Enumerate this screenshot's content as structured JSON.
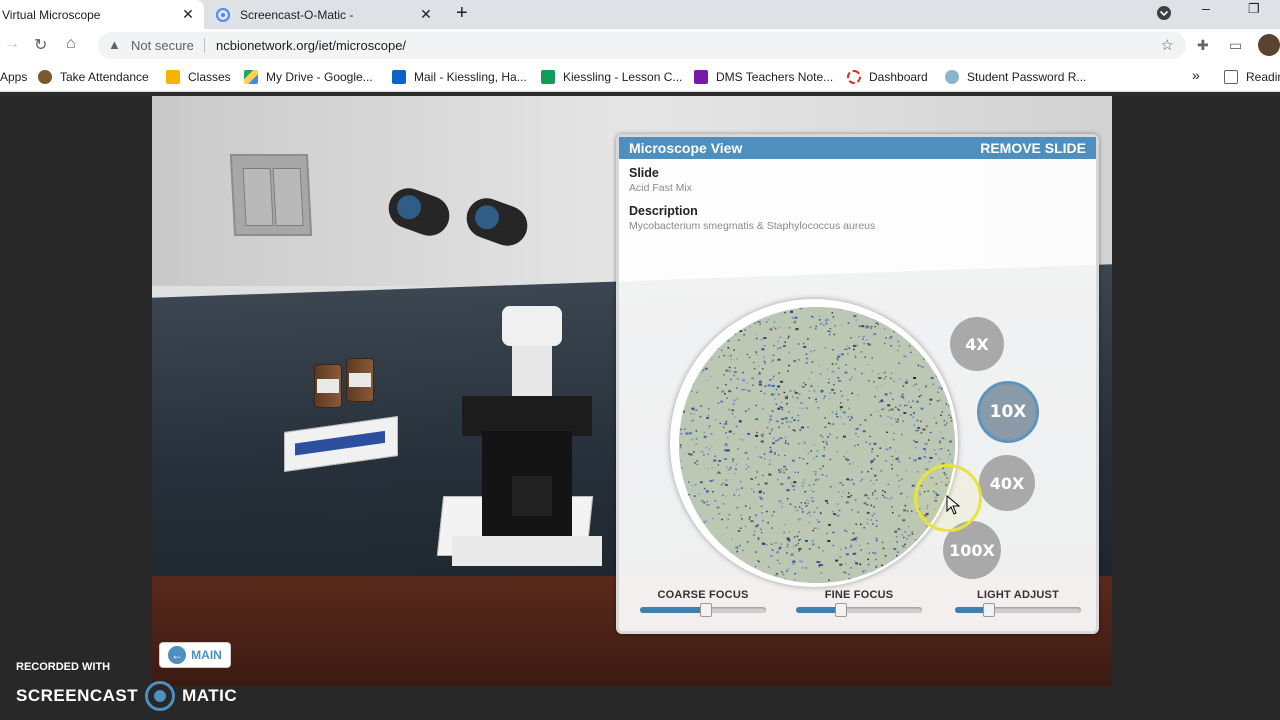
{
  "browser": {
    "tabs": [
      {
        "title": "Virtual Microscope",
        "active": true
      },
      {
        "title": "Screencast-O-Matic -",
        "active": false
      }
    ],
    "address": {
      "security": "Not secure",
      "url": "ncbionetwork.org/iet/microscope/"
    },
    "bookmarks": [
      {
        "label": "Apps",
        "icon": "apps-icon",
        "color": "#5f6368"
      },
      {
        "label": "Take Attendance",
        "icon": "attendance-icon",
        "color": "#7a5a2a"
      },
      {
        "label": "Classes",
        "icon": "classroom-icon",
        "color": "#f4b400"
      },
      {
        "label": "My Drive - Google...",
        "icon": "drive-icon",
        "color": "#1fa463"
      },
      {
        "label": "Mail - Kiessling, Ha...",
        "icon": "outlook-icon",
        "color": "#0a64c8"
      },
      {
        "label": "Kiessling - Lesson C...",
        "icon": "planner-icon",
        "color": "#0f9d58"
      },
      {
        "label": "DMS Teachers Note...",
        "icon": "onenote-icon",
        "color": "#7719aa"
      },
      {
        "label": "Dashboard",
        "icon": "dashboard-icon",
        "color": "#d93025"
      },
      {
        "label": "Student Password R...",
        "icon": "lightbulb-icon",
        "color": "#8ab4c8"
      }
    ],
    "bookmarks_more": "»",
    "reading_list": "Readin"
  },
  "panel": {
    "title": "Microscope View",
    "remove_label": "REMOVE SLIDE",
    "slide_heading": "Slide",
    "slide_value": "Acid Fast Mix",
    "desc_heading": "Description",
    "desc_value": "Mycobacterium smegmatis & Staphylococcus aureus",
    "objectives": [
      {
        "label": "4X",
        "selected": false
      },
      {
        "label": "10X",
        "selected": true
      },
      {
        "label": "40X",
        "selected": false
      },
      {
        "label": "100X",
        "selected": false
      }
    ],
    "sliders": [
      {
        "label": "COARSE FOCUS",
        "value": 0.52
      },
      {
        "label": "FINE FOCUS",
        "value": 0.36
      },
      {
        "label": "LIGHT ADJUST",
        "value": 0.27
      }
    ]
  },
  "main_button": "MAIN",
  "watermark": {
    "line1": "RECORDED WITH",
    "brand_left": "SCREENCAST",
    "brand_right": "MATIC"
  },
  "colors": {
    "accent": "#4d8fbf",
    "specimen_bg": "#bcc7b4",
    "specimen_dots": [
      "#1f3f8a",
      "#2c5db0",
      "#3a2a1a",
      "#6b8fd0"
    ]
  }
}
